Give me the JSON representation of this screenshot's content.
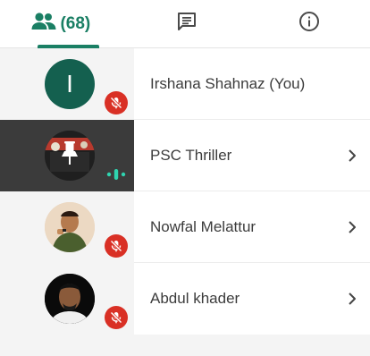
{
  "tabs": [
    {
      "name": "people",
      "icon": "people-icon",
      "count_label": "(68)",
      "active": true
    },
    {
      "name": "chat",
      "icon": "chat-icon",
      "active": false
    },
    {
      "name": "info",
      "icon": "info-icon",
      "active": false
    }
  ],
  "accent_color": "#1a7f64",
  "participants": [
    {
      "name": "Irshana Shahnaz (You)",
      "avatar_initial": "I",
      "muted": true,
      "has_menu": false
    },
    {
      "name": "PSC Thriller",
      "avatar_initial": "",
      "pinned_icon": "pin-icon",
      "speaking": true,
      "has_menu": true
    },
    {
      "name": "Nowfal Melattur",
      "avatar_initial": "",
      "muted": true,
      "has_menu": true
    },
    {
      "name": "Abdul khader",
      "avatar_initial": "",
      "muted": true,
      "has_menu": true
    }
  ]
}
